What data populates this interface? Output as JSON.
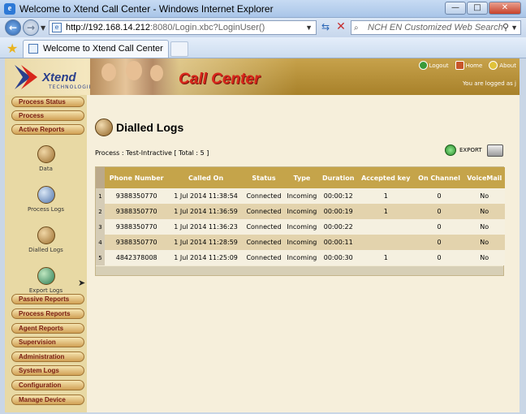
{
  "window": {
    "title": "Welcome to Xtend Call Center - Windows Internet Explorer",
    "minimize": "—",
    "maximize": "□",
    "close": "✕"
  },
  "address": {
    "url_host": "http://192.168.14.212",
    "url_rest": ":8080/Login.xbc?LoginUser()",
    "search_placeholder": "NCH EN Customized Web Search"
  },
  "tabs": [
    {
      "label": "Welcome to Xtend Call Center"
    }
  ],
  "banner": {
    "logo_name": "Xtend",
    "logo_sub": "TECHNOLOGIES",
    "title": "Call Center",
    "links": {
      "logout": "Logout",
      "home": "Home",
      "about": "About"
    },
    "logged_in": "You are logged as j"
  },
  "sidebar": {
    "top_menu": [
      "Process Status",
      "Process",
      "Active Reports"
    ],
    "icons": [
      "Data",
      "Process Logs",
      "Dialled Logs",
      "Export Logs"
    ],
    "bottom_menu": [
      "Passive Reports",
      "Process Reports",
      "Agent Reports",
      "Supervision",
      "Administration",
      "System Logs",
      "Configuration",
      "Manage Device"
    ]
  },
  "main": {
    "heading": "Dialled Logs",
    "process_line": "Process : Test-Intractive [ Total : 5 ]",
    "export_label": "EXPORT",
    "columns": [
      "Phone Number",
      "Called On",
      "Status",
      "Type",
      "Duration",
      "Accepted key",
      "On Channel",
      "VoiceMail"
    ],
    "rows": [
      {
        "n": "1",
        "phone": "9388350770",
        "called": "1 Jul 2014 11:38:54",
        "status": "Connected",
        "type": "Incoming",
        "duration": "00:00:12",
        "key": "1",
        "channel": "0",
        "voicemail": "No"
      },
      {
        "n": "2",
        "phone": "9388350770",
        "called": "1 Jul 2014 11:36:59",
        "status": "Connected",
        "type": "Incoming",
        "duration": "00:00:19",
        "key": "1",
        "channel": "0",
        "voicemail": "No"
      },
      {
        "n": "3",
        "phone": "9388350770",
        "called": "1 Jul 2014 11:36:23",
        "status": "Connected",
        "type": "Incoming",
        "duration": "00:00:22",
        "key": "",
        "channel": "0",
        "voicemail": "No"
      },
      {
        "n": "4",
        "phone": "9388350770",
        "called": "1 Jul 2014 11:28:59",
        "status": "Connected",
        "type": "Incoming",
        "duration": "00:00:11",
        "key": "",
        "channel": "0",
        "voicemail": "No"
      },
      {
        "n": "5",
        "phone": "4842378008",
        "called": "1 Jul 2014 11:25:09",
        "status": "Connected",
        "type": "Incoming",
        "duration": "00:00:30",
        "key": "1",
        "channel": "0",
        "voicemail": "No"
      }
    ]
  },
  "colors": {
    "banner": "#b48d34",
    "header_row": "#c5a44a",
    "brand_red": "#d8261b",
    "menu_text": "#7a1b10"
  }
}
